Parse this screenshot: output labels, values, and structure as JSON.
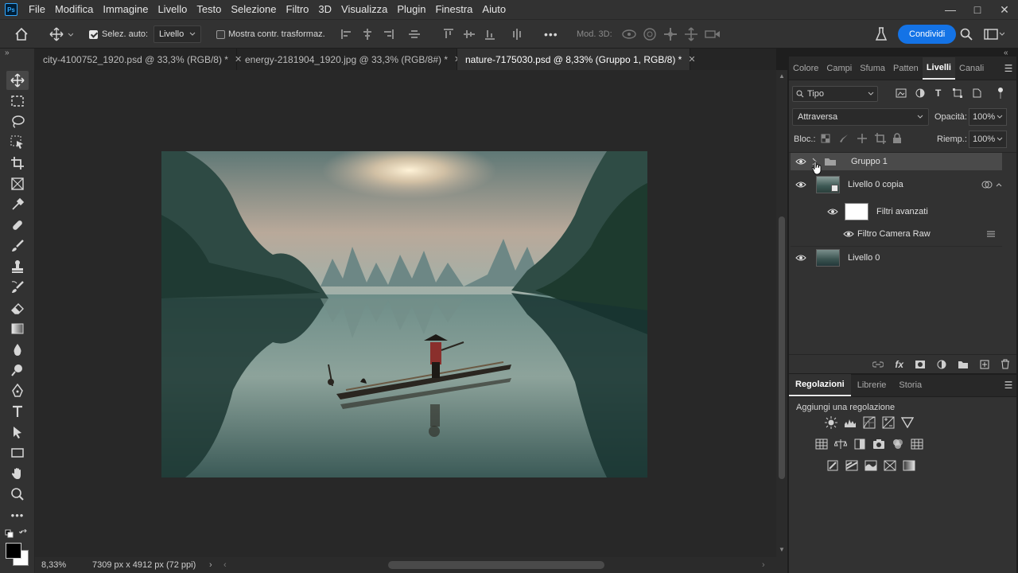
{
  "app": {
    "logo": "Ps"
  },
  "menu": [
    "File",
    "Modifica",
    "Immagine",
    "Livello",
    "Testo",
    "Selezione",
    "Filtro",
    "3D",
    "Visualizza",
    "Plugin",
    "Finestra",
    "Aiuto"
  ],
  "options": {
    "auto_select_label": "Selez. auto:",
    "auto_select_value": "Livello",
    "show_transform_label": "Mostra contr. trasformaz.",
    "mode_3d_label": "Mod. 3D:",
    "share_label": "Condividi",
    "more": "•••"
  },
  "tabs": [
    {
      "label": "city-4100752_1920.psd @ 33,3% (RGB/8) *",
      "active": false
    },
    {
      "label": "energy-2181904_1920.jpg @ 33,3% (RGB/8#) *",
      "active": false
    },
    {
      "label": "nature-7175030.psd @ 8,33% (Gruppo 1, RGB/8) *",
      "active": true
    }
  ],
  "status": {
    "zoom": "8,33%",
    "doc_info": "7309 px x 4912 px (72 ppi)"
  },
  "layers_panel": {
    "tabs": [
      "Colore",
      "Campi",
      "Sfuma",
      "Patten",
      "Livelli",
      "Canali"
    ],
    "active_tab": "Livelli",
    "filter_label": "Tipo",
    "blend_mode": "Attraversa",
    "opacity_label": "Opacità:",
    "opacity_value": "100%",
    "lock_label": "Bloc.:",
    "fill_label": "Riemp.:",
    "fill_value": "100%",
    "layers": {
      "group": "Gruppo 1",
      "copy": "Livello 0 copia",
      "smart_filters": "Filtri avanzati",
      "camera_raw": "Filtro Camera Raw",
      "base": "Livello 0"
    }
  },
  "adjust_panel": {
    "tabs": [
      "Regolazioni",
      "Librerie",
      "Storia"
    ],
    "active_tab": "Regolazioni",
    "add_label": "Aggiungi una regolazione"
  },
  "colors": {
    "accent": "#1473e6",
    "panel": "#323232",
    "canvas": "#282828"
  }
}
